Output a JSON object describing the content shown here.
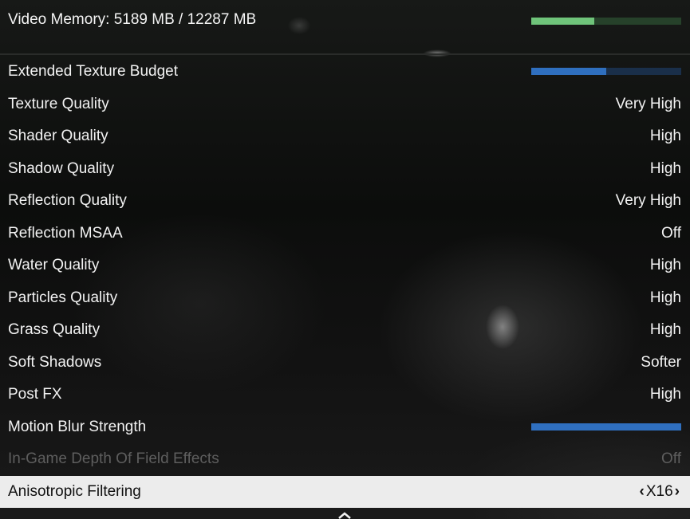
{
  "header": {
    "title": "Video Memory: 5189 MB / 12287 MB",
    "vram_used_mb": 5189,
    "vram_total_mb": 12287,
    "vram_fill_fraction": 0.42,
    "bar_color": "#6fc47a"
  },
  "settings": [
    {
      "label": "Extended Texture Budget",
      "type": "slider",
      "level": 0.5
    },
    {
      "label": "Texture Quality",
      "value": "Very High"
    },
    {
      "label": "Shader Quality",
      "value": "High"
    },
    {
      "label": "Shadow Quality",
      "value": "High"
    },
    {
      "label": "Reflection Quality",
      "value": "Very High"
    },
    {
      "label": "Reflection MSAA",
      "value": "Off"
    },
    {
      "label": "Water Quality",
      "value": "High"
    },
    {
      "label": "Particles Quality",
      "value": "High"
    },
    {
      "label": "Grass Quality",
      "value": "High"
    },
    {
      "label": "Soft Shadows",
      "value": "Softer"
    },
    {
      "label": "Post FX",
      "value": "High"
    },
    {
      "label": "Motion Blur Strength",
      "type": "slider",
      "level": 1.0
    },
    {
      "label": "In-Game Depth Of Field Effects",
      "value": "Off",
      "disabled": true
    },
    {
      "label": "Anisotropic Filtering",
      "value": "X16",
      "selected": true
    }
  ],
  "icons": {
    "left_arrow": "chevron-left-icon",
    "right_arrow": "chevron-right-icon",
    "scroll": "chevron-up-icon"
  },
  "colors": {
    "slider_fill": "#2f6fbf",
    "slider_track": "#1a2f4a",
    "selected_row_bg": "#ececec",
    "disabled_text": "#5e5e5e"
  }
}
